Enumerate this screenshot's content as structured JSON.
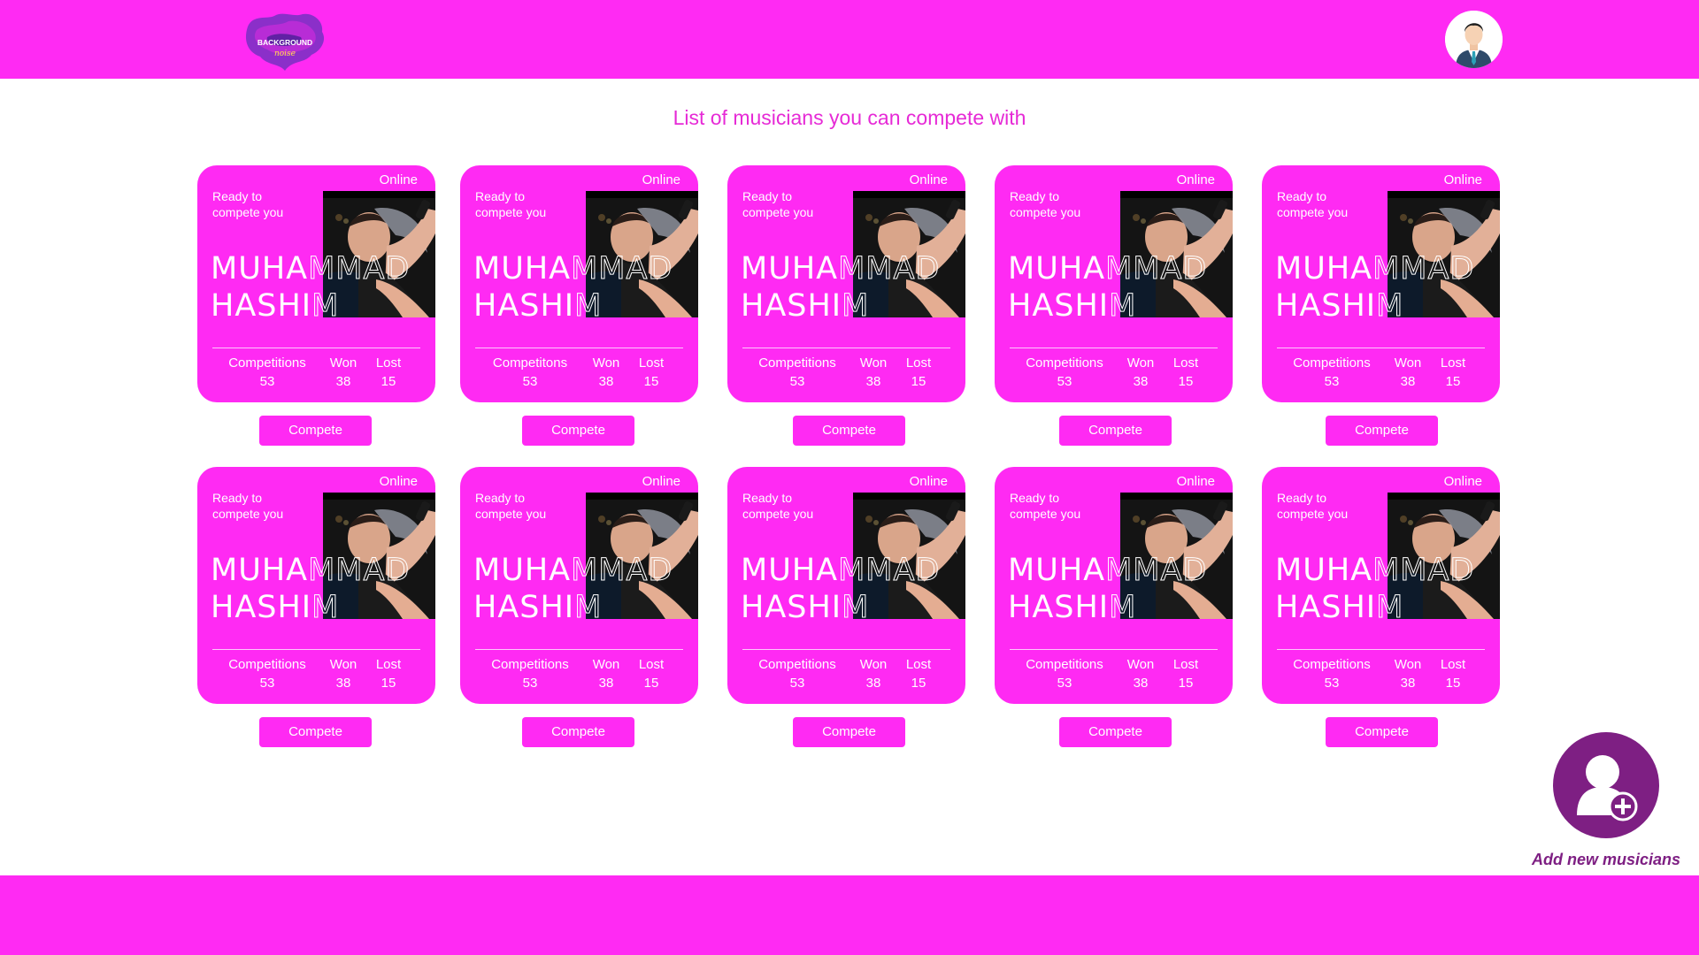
{
  "header": {
    "logo_text": [
      "BACKGROUND",
      "noise"
    ],
    "avatar_icon": "user-avatar-icon"
  },
  "page": {
    "title": "List of musicians you can compete with"
  },
  "colors": {
    "brand": "#ff2af3",
    "accent_dark": "#7e1f83",
    "text_title": "#e62ad6"
  },
  "musician_cards": [
    {
      "status": "Online",
      "ready": "Ready to compete you",
      "name_line1": "MUHAMMAD",
      "name_line2": "HASHIM",
      "competitions_label": "Competitions",
      "competitions": "53",
      "won_label": "Won",
      "won": "38",
      "lost_label": "Lost",
      "lost": "15",
      "button": "Compete"
    },
    {
      "status": "Online",
      "ready": "Ready to compete you",
      "name_line1": "MUHAMMAD",
      "name_line2": "HASHIM",
      "competitions_label": "Competitons",
      "competitions": "53",
      "won_label": "Won",
      "won": "38",
      "lost_label": "Lost",
      "lost": "15",
      "button": "Compete"
    },
    {
      "status": "Online",
      "ready": "Ready to compete you",
      "name_line1": "MUHAMMAD",
      "name_line2": "HASHIM",
      "competitions_label": "Competitions",
      "competitions": "53",
      "won_label": "Won",
      "won": "38",
      "lost_label": "Lost",
      "lost": "15",
      "button": "Compete"
    },
    {
      "status": "Online",
      "ready": "Ready to compete you",
      "name_line1": "MUHAMMAD",
      "name_line2": "HASHIM",
      "competitions_label": "Competitions",
      "competitions": "53",
      "won_label": "Won",
      "won": "38",
      "lost_label": "Lost",
      "lost": "15",
      "button": "Compete"
    },
    {
      "status": "Online",
      "ready": "Ready to compete you",
      "name_line1": "MUHAMMAD",
      "name_line2": "HASHIM",
      "competitions_label": "Competitions",
      "competitions": "53",
      "won_label": "Won",
      "won": "38",
      "lost_label": "Lost",
      "lost": "15",
      "button": "Compete"
    },
    {
      "status": "Online",
      "ready": "Ready to compete you",
      "name_line1": "MUHAMMAD",
      "name_line2": "HASHIM",
      "competitions_label": "Competitions",
      "competitions": "53",
      "won_label": "Won",
      "won": "38",
      "lost_label": "Lost",
      "lost": "15",
      "button": "Compete"
    },
    {
      "status": "Online",
      "ready": "Ready to compete you",
      "name_line1": "MUHAMMAD",
      "name_line2": "HASHIM",
      "competitions_label": "Competitions",
      "competitions": "53",
      "won_label": "Won",
      "won": "38",
      "lost_label": "Lost",
      "lost": "15",
      "button": "Compete"
    },
    {
      "status": "Online",
      "ready": "Ready to compete you",
      "name_line1": "MUHAMMAD",
      "name_line2": "HASHIM",
      "competitions_label": "Competitions",
      "competitions": "53",
      "won_label": "Won",
      "won": "38",
      "lost_label": "Lost",
      "lost": "15",
      "button": "Compete"
    },
    {
      "status": "Online",
      "ready": "Ready to compete you",
      "name_line1": "MUHAMMAD",
      "name_line2": "HASHIM",
      "competitions_label": "Competitions",
      "competitions": "53",
      "won_label": "Won",
      "won": "38",
      "lost_label": "Lost",
      "lost": "15",
      "button": "Compete"
    },
    {
      "status": "Online",
      "ready": "Ready to compete you",
      "name_line1": "MUHAMMAD",
      "name_line2": "HASHIM",
      "competitions_label": "Competitions",
      "competitions": "53",
      "won_label": "Won",
      "won": "38",
      "lost_label": "Lost",
      "lost": "15",
      "button": "Compete"
    }
  ],
  "add_musician": {
    "icon": "add-user-icon",
    "label": "Add new musicians"
  }
}
